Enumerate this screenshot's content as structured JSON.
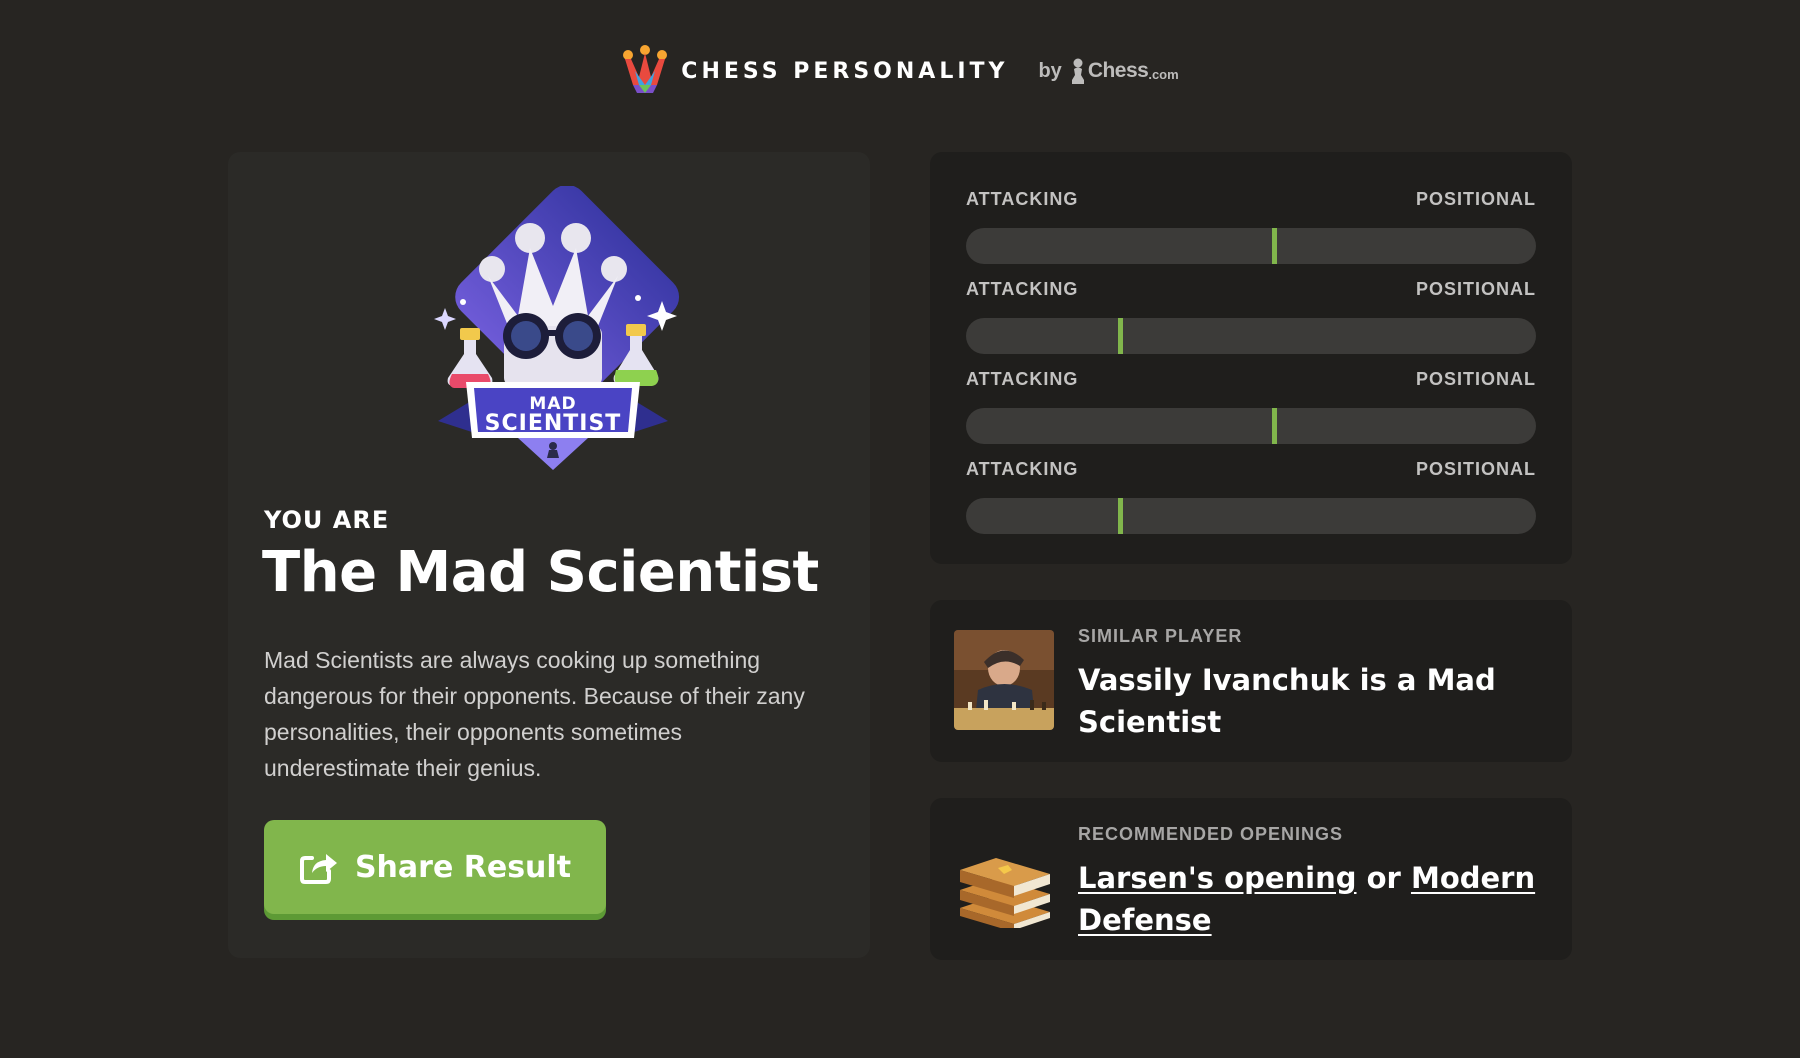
{
  "header": {
    "brand": "CHESS PERSONALITY",
    "by": "by",
    "chess_word": "Chess",
    "chess_suffix": ".com"
  },
  "result": {
    "badge_line1": "MAD",
    "badge_line2": "SCIENTIST",
    "you_are": "YOU ARE",
    "title": "The Mad Scientist",
    "description": "Mad Scientists are always cooking up something dangerous for their opponents. Because of their zany personalities, their opponents sometimes underestimate their genius.",
    "share_label": "Share Result"
  },
  "sliders": [
    {
      "left": "ATTACKING",
      "right": "POSITIONAL",
      "value": 0.54
    },
    {
      "left": "ATTACKING",
      "right": "POSITIONAL",
      "value": 0.27
    },
    {
      "left": "ATTACKING",
      "right": "POSITIONAL",
      "value": 0.54
    },
    {
      "left": "ATTACKING",
      "right": "POSITIONAL",
      "value": 0.27
    }
  ],
  "similar_player": {
    "kicker": "SIMILAR PLAYER",
    "text": "Vassily Ivanchuk is a Mad Scientist"
  },
  "recommended_openings": {
    "kicker": "RECOMMENDED OPENINGS",
    "opening1": "Larsen's opening",
    "or": "or",
    "opening2": "Modern Defense"
  },
  "colors": {
    "background": "#272522",
    "card": "#2b2a27",
    "panel": "#1f1e1c",
    "accent": "#81b64c",
    "track": "#3c3b39"
  },
  "icons": {
    "logo": "rainbow-crown-icon",
    "chesscom": "pawn-icon",
    "share": "share-arrow-icon",
    "openings": "books-icon"
  }
}
